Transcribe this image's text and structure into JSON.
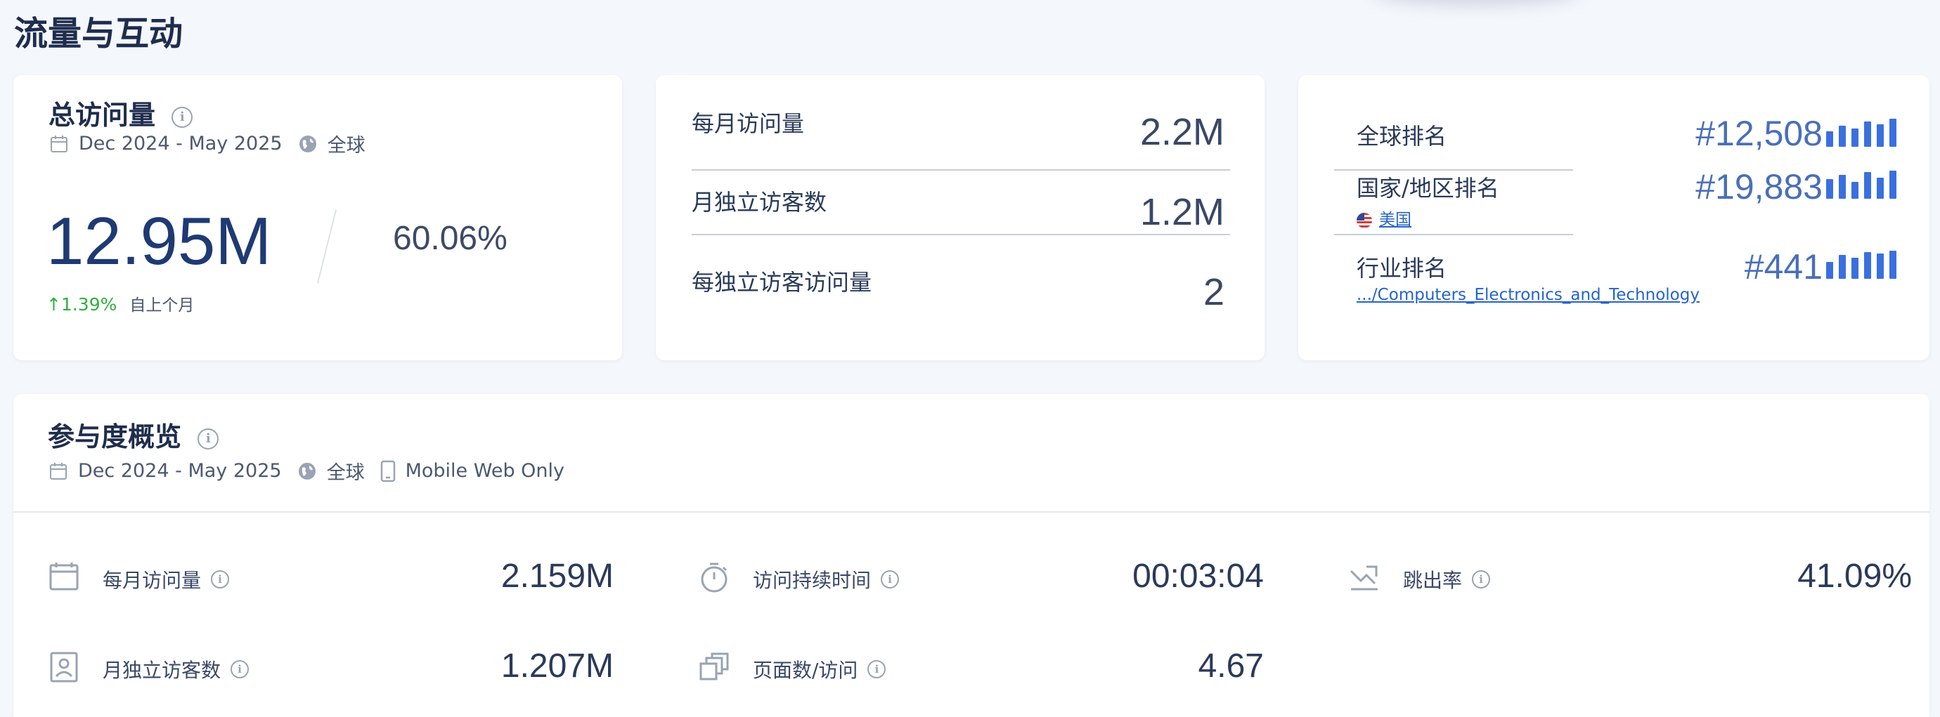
{
  "section_title": "流量与互动",
  "total_card": {
    "title": "总访问量",
    "date_range": "Dec 2024 - May 2025",
    "region": "全球",
    "value": "12.95M",
    "share": "60.06%",
    "change": "↑1.39%",
    "change_label": "自上个月"
  },
  "monthly_card": {
    "rows": [
      {
        "label": "每月访问量",
        "value": "2.2M"
      },
      {
        "label": "月独立访客数",
        "value": "1.2M"
      },
      {
        "label": "每独立访客访问量",
        "value": "2"
      }
    ]
  },
  "rank_card": {
    "global": {
      "label": "全球排名",
      "value": "#12,508"
    },
    "country": {
      "label": "国家/地区排名",
      "link": "美国",
      "value": "#19,883"
    },
    "industry": {
      "label": "行业排名",
      "link": ".../Computers_Electronics_and_Technology",
      "value": "#441"
    }
  },
  "engage_card": {
    "title": "参与度概览",
    "date_range": "Dec 2024 - May 2025",
    "region": "全球",
    "device": "Mobile Web Only",
    "metrics": {
      "monthly_visits": {
        "label": "每月访问量",
        "value": "2.159M"
      },
      "duration": {
        "label": "访问持续时间",
        "value": "00:03:04"
      },
      "bounce": {
        "label": "跳出率",
        "value": "41.09%"
      },
      "unique": {
        "label": "月独立访客数",
        "value": "1.207M"
      },
      "pages": {
        "label": "页面数/访问",
        "value": "4.67"
      }
    }
  },
  "colors": {
    "accent_blue": "#3a6fe0",
    "positive_green": "#2eae3f",
    "link_blue": "#2563c8"
  },
  "icons": [
    "info-icon",
    "calendar-icon",
    "globe-icon",
    "mobile-icon",
    "bar-chart-icon",
    "flag-icon",
    "timer-icon",
    "bounce-arrow-icon",
    "visitor-card-icon",
    "pages-icon"
  ]
}
